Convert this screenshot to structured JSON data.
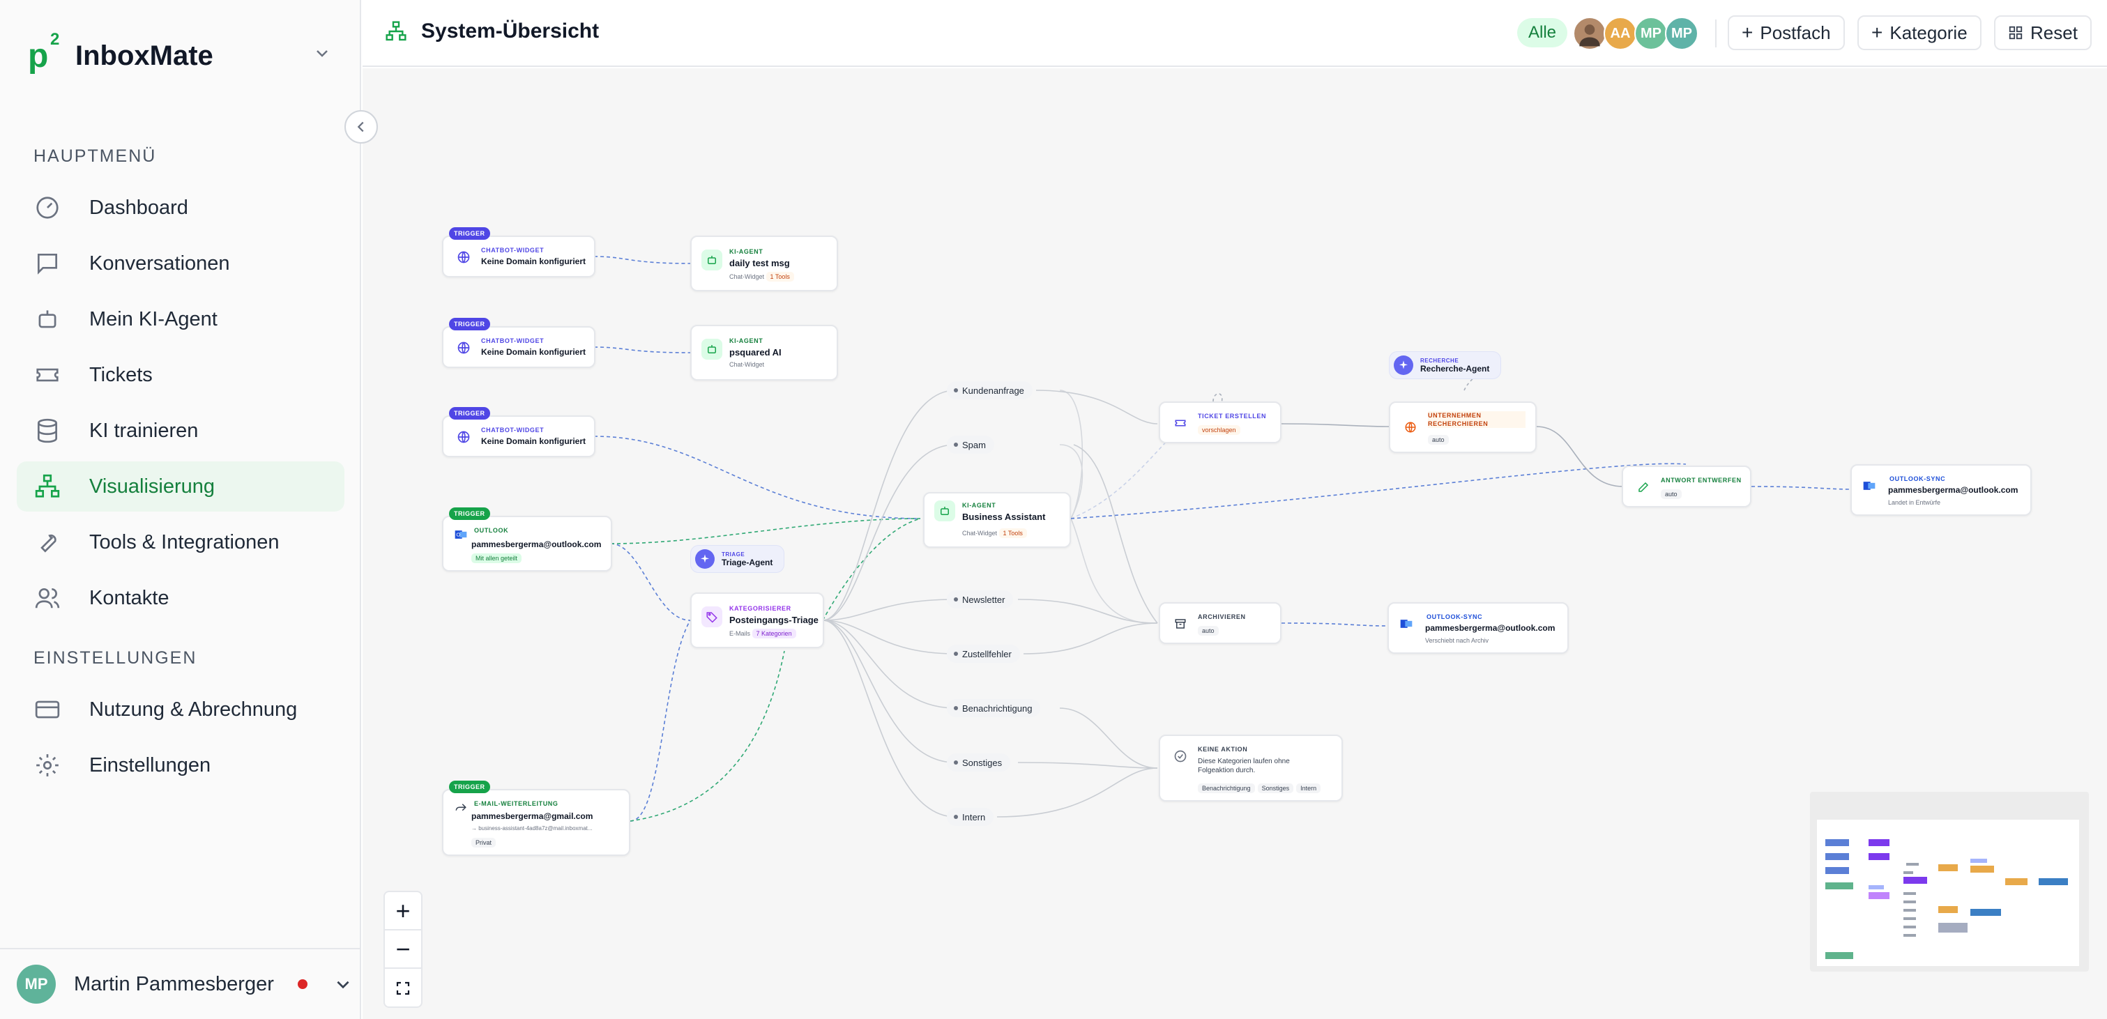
{
  "brand": {
    "mark": "p",
    "mark_sup": "2",
    "name": "InboxMate"
  },
  "sidebar": {
    "section_main": "HAUPTMENÜ",
    "section_settings": "EINSTELLUNGEN",
    "items": [
      {
        "label": "Dashboard",
        "icon": "gauge-icon"
      },
      {
        "label": "Konversationen",
        "icon": "chat-bubble-icon"
      },
      {
        "label": "Mein KI-Agent",
        "icon": "robot-icon"
      },
      {
        "label": "Tickets",
        "icon": "ticket-icon"
      },
      {
        "label": "KI trainieren",
        "icon": "database-icon"
      },
      {
        "label": "Visualisierung",
        "icon": "network-icon",
        "active": true
      },
      {
        "label": "Tools & Integrationen",
        "icon": "wrench-icon"
      },
      {
        "label": "Kontakte",
        "icon": "users-icon"
      }
    ],
    "settings_items": [
      {
        "label": "Nutzung & Abrechnung",
        "icon": "credit-card-icon"
      },
      {
        "label": "Einstellungen",
        "icon": "gear-icon"
      }
    ],
    "user": {
      "initials": "MP",
      "name": "Martin Pammesberger"
    }
  },
  "header": {
    "title": "System-Übersicht",
    "filter_all": "Alle",
    "avatars": [
      "AA",
      "MP",
      "MP"
    ],
    "buttons": {
      "postfach": "Postfach",
      "kategorie": "Kategorie",
      "reset": "Reset"
    }
  },
  "nodes": {
    "trigger_tag": "TRIGGER",
    "cw1": {
      "type": "CHATBOT-WIDGET",
      "title": "Keine Domain konfiguriert"
    },
    "cw2": {
      "type": "CHATBOT-WIDGET",
      "title": "Keine Domain konfiguriert"
    },
    "cw3": {
      "type": "CHATBOT-WIDGET",
      "title": "Keine Domain konfiguriert"
    },
    "ka1": {
      "type": "KI-AGENT",
      "title": "daily test msg",
      "sub": "Chat-Widget",
      "chip": "1 Tools"
    },
    "ka2": {
      "type": "KI-AGENT",
      "title": "psquared AI",
      "sub": "Chat-Widget"
    },
    "outlook": {
      "type": "OUTLOOK",
      "title": "pammesbergerma@outlook.com",
      "chip": "Mit allen geteilt"
    },
    "triage": {
      "type": "TRIAGE",
      "title": "Triage-Agent"
    },
    "kat": {
      "type": "KATEGORISIERER",
      "title": "Posteingangs-Triage",
      "sub": "E-Mails",
      "chip": "7 Kategorien"
    },
    "fwd": {
      "type": "E-MAIL-WEITERLEITUNG",
      "title": "pammesbergerma@gmail.com",
      "sub": "→ business-assistant-4ad8a7z@mail.inboxmat...",
      "chip": "Privat"
    },
    "ba": {
      "type": "KI-AGENT",
      "title": "Business Assistant",
      "sub": "Chat-Widget",
      "chip": "1 Tools"
    },
    "categories": [
      "Kundenanfrage",
      "Spam",
      "Newsletter",
      "Zustellfehler",
      "Benachrichtigung",
      "Sonstiges",
      "Intern"
    ],
    "ticket": {
      "type": "TICKET ERSTELLEN",
      "chip": "vorschlagen"
    },
    "recherche": {
      "type": "RECHERCHE",
      "title": "Recherche-Agent"
    },
    "unternehmen": {
      "type": "UNTERNEHMEN RECHERCHIEREN",
      "chip": "auto"
    },
    "antwort": {
      "type": "ANTWORT ENTWERFEN",
      "chip": "auto"
    },
    "osync1": {
      "type": "OUTLOOK-SYNC",
      "title": "pammesbergerma@outlook.com",
      "sub": "Landet in Entwürfe"
    },
    "archiv": {
      "type": "ARCHIVIEREN",
      "chip": "auto"
    },
    "osync2": {
      "type": "OUTLOOK-SYNC",
      "title": "pammesbergerma@outlook.com",
      "sub": "Verschiebt nach Archiv"
    },
    "keine": {
      "type": "KEINE AKTION",
      "desc": "Diese Kategorien laufen ohne Folgeaktion durch.",
      "chips": [
        "Benachrichtigung",
        "Sonstiges",
        "Intern"
      ]
    }
  },
  "controls": {
    "zoom_in": "+",
    "zoom_out": "−"
  }
}
